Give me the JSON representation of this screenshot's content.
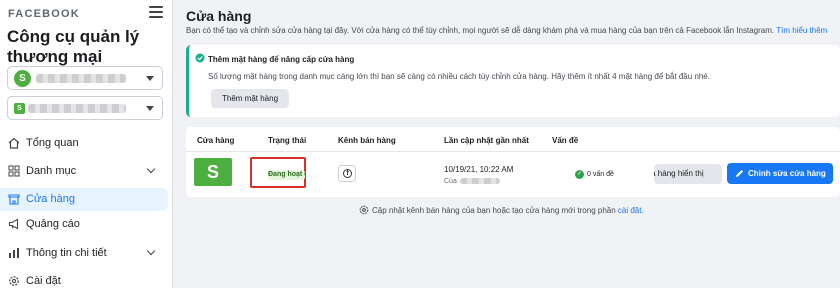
{
  "sidebar": {
    "brand": "FACEBOOK",
    "app_title": "Công cụ quản lý thương mại",
    "account_avatar_letter": "S",
    "shop_avatar_letter": "S",
    "items": [
      {
        "label": "Tổng quan",
        "icon": "home-icon"
      },
      {
        "label": "Danh mục",
        "icon": "grid-icon"
      },
      {
        "label": "Cửa hàng",
        "icon": "store-icon"
      },
      {
        "label": "Quảng cáo",
        "icon": "megaphone-icon"
      },
      {
        "label": "Thông tin chi tiết",
        "icon": "bar-chart-icon"
      },
      {
        "label": "Cài đặt",
        "icon": "gear-icon"
      }
    ],
    "active_item": "Cửa hàng"
  },
  "main": {
    "title": "Cửa hàng",
    "description": "Bạn có thể tạo và chỉnh sửa cửa hàng tại đây. Với cửa hàng có thể tùy chỉnh, mọi người sẽ dễ dàng khám phá và mua hàng của bạn trên cả Facebook lẫn Instagram. ",
    "learn_more": "Tìm hiểu thêm",
    "notice": {
      "title": "Thêm mặt hàng để nâng cấp cửa hàng",
      "text": "Số lượng mặt hàng trong danh mục càng lớn thì bạn sẽ càng có nhiều cách tùy chỉnh cửa hàng. Hãy thêm ít nhất 4 mặt hàng để bắt đầu nhé.",
      "button": "Thêm mặt hàng"
    },
    "table": {
      "headers": {
        "shop": "Cửa hàng",
        "status": "Trạng thái",
        "channel": "Kênh bán hàng",
        "last_updated": "Lần cập nhật gần nhất",
        "issues": "Vấn đề"
      },
      "row": {
        "thumb_letter": "S",
        "status": "Đang hoạt động",
        "channel_icon_letter": "f",
        "updated_date": "10/19/21, 10:22 AM",
        "updated_by": "Của",
        "issues": "0 vấn đề",
        "hidden_button": "Cửa hàng hiển thị",
        "edit_button": "Chỉnh sửa cửa hàng"
      }
    },
    "footer_note": "Cập nhật kênh bán hàng của bạn hoặc tạo cửa hàng mới trong phần ",
    "footer_link": "cài đặt."
  },
  "colors": {
    "accent": "#1877f2",
    "success": "#31a24c",
    "notice_border": "#1bad8e",
    "highlight": "#d93025",
    "shop_green": "#4caf3f"
  }
}
